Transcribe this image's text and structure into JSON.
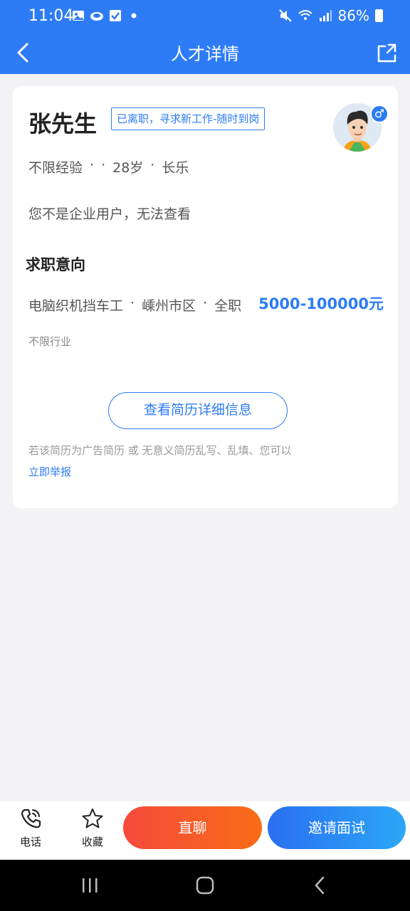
{
  "status_bar": {
    "time": "11:04",
    "battery": "86%"
  },
  "header": {
    "title": "人才详情"
  },
  "profile": {
    "name": "张先生",
    "status_tag": "已离职，寻求新工作-随时到岗",
    "meta": [
      "不限经验",
      "·",
      "·",
      "28岁",
      "·",
      "长乐"
    ],
    "notice": "您不是企业用户，无法查看"
  },
  "job_intent": {
    "section_title": "求职意向",
    "items": [
      "电脑织机挡车工",
      "·",
      "嵊州市区",
      "·",
      "全职"
    ],
    "salary": "5000-100000元",
    "industry": "不限行业"
  },
  "view_resume_button": "查看简历详细信息",
  "report": {
    "text": "若该简历为广告简历 或 无意义简历乱写、乱填、您可以",
    "link": "立即举报"
  },
  "bottom_bar": {
    "phone_label": "电话",
    "favorite_label": "收藏",
    "chat_label": "直聊",
    "invite_label": "邀请面试"
  },
  "colors": {
    "primary": "#2d7cf6",
    "chat_start": "#f54a3d",
    "chat_end": "#f86d16"
  }
}
